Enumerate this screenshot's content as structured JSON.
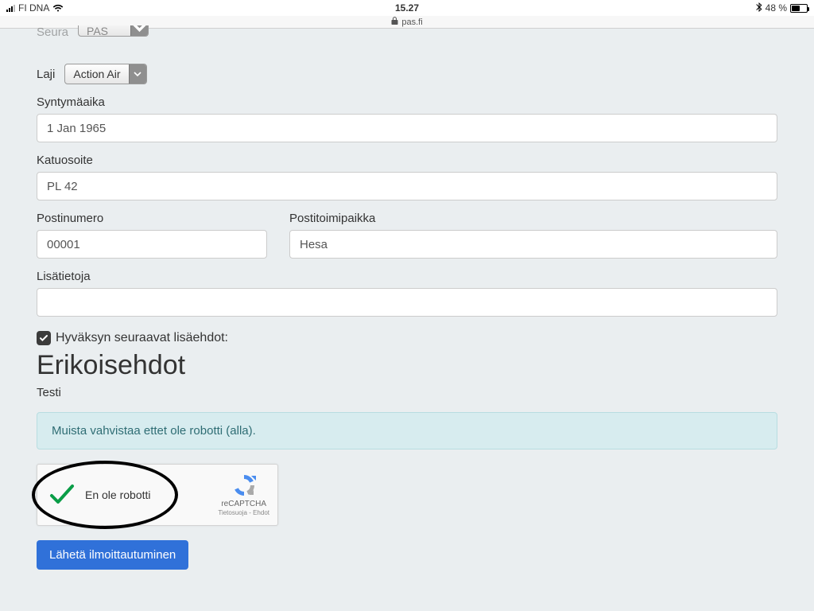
{
  "statusbar": {
    "carrier": "FI DNA",
    "time": "15.27",
    "battery_text": "48 %",
    "battery_level": 48
  },
  "addressbar": {
    "host": "pas.fi"
  },
  "form": {
    "seura": {
      "label": "Seura",
      "value": "PAS"
    },
    "laji": {
      "label": "Laji",
      "value": "Action Air"
    },
    "syntymaaika": {
      "label": "Syntymäaika",
      "value": "1 Jan 1965"
    },
    "katuosoite": {
      "label": "Katuosoite",
      "value": "PL 42"
    },
    "postinumero": {
      "label": "Postinumero",
      "value": "00001"
    },
    "postitoimipaikka": {
      "label": "Postitoimipaikka",
      "value": "Hesa"
    },
    "lisatietoja": {
      "label": "Lisätietoja",
      "value": ""
    },
    "accept_terms": {
      "label": "Hyväksyn seuraavat lisäehdot:",
      "checked": true
    },
    "special_heading": "Erikoisehdot",
    "special_sub": "Testi",
    "info_banner": "Muista vahvistaa ettet ole robotti (alla).",
    "recaptcha": {
      "label": "En ole robotti",
      "brand": "reCAPTCHA",
      "links": "Tietosuoja - Ehdot",
      "verified": true
    },
    "submit_label": "Lähetä ilmoittautuminen"
  }
}
